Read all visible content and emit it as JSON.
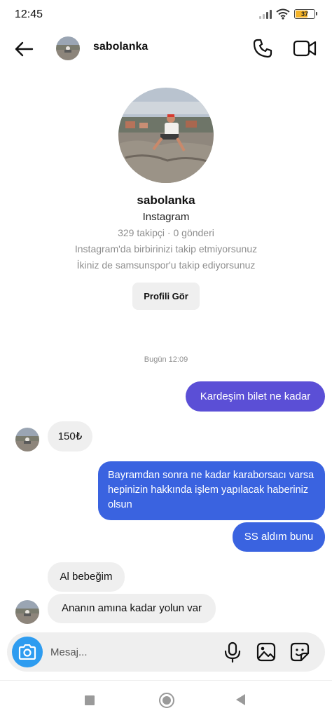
{
  "status_bar": {
    "time": "12:45",
    "battery": "37",
    "icons": [
      "signal-icon",
      "wifi-icon",
      "battery-icon"
    ]
  },
  "header": {
    "username": "sabolanka",
    "icons": [
      "back-arrow-icon",
      "phone-icon",
      "video-camera-icon"
    ]
  },
  "profile": {
    "username": "sabolanka",
    "app": "Instagram",
    "stats": "329 takipçi · 0 gönderi",
    "follow_status": "Instagram'da birbirinizi takip etmiyorsunuz",
    "mutual": "İkiniz de samsunspor'u takip ediyorsunuz",
    "view_profile_label": "Profili Gör"
  },
  "chat": {
    "timestamp": "Bugün 12:09",
    "messages": [
      {
        "sender": "me",
        "text": "Kardeşim bilet ne kadar"
      },
      {
        "sender": "them",
        "text": "150₺"
      },
      {
        "sender": "me",
        "text": "Bayramdan sonra ne kadar karaborsacı varsa hepinizin hakkında işlem yapılacak haberiniz olsun"
      },
      {
        "sender": "me",
        "text": "SS aldım bunu"
      },
      {
        "sender": "them",
        "text": "Al bebeğim"
      },
      {
        "sender": "them",
        "text": "Ananın amına kadar yolun var"
      }
    ]
  },
  "composer": {
    "placeholder": "Mesaj...",
    "value": "",
    "icons": [
      "camera-icon",
      "microphone-icon",
      "gallery-icon",
      "sticker-icon"
    ]
  },
  "colors": {
    "outgoing_bubble": "#3a63e0",
    "outgoing_bubble_first": "#5b4fd6",
    "incoming_bubble": "#efefef",
    "camera_button": "#2e9cf0",
    "meta_text": "#8e8e8e"
  },
  "navbar": {
    "icons": [
      "recents-square-icon",
      "home-circle-icon",
      "back-triangle-icon"
    ]
  }
}
